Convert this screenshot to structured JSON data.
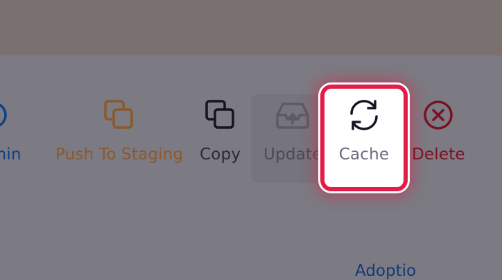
{
  "toolbar": {
    "items": [
      {
        "label": "dmin",
        "icon": "circle-icon"
      },
      {
        "label": "Push To Staging",
        "icon": "copy-icon"
      },
      {
        "label": "Copy",
        "icon": "copy-icon"
      },
      {
        "label": "Update",
        "icon": "upload-tray-icon"
      },
      {
        "label": "Cache",
        "icon": "refresh-icon"
      },
      {
        "label": "Delete",
        "icon": "close-circle-icon"
      }
    ]
  },
  "bottom": {
    "link_text": "Adoptio"
  },
  "colors": {
    "highlight": "#e11d48",
    "push": "#8a5a2c",
    "admin": "#0d3f8a",
    "delete": "#7a1022"
  }
}
